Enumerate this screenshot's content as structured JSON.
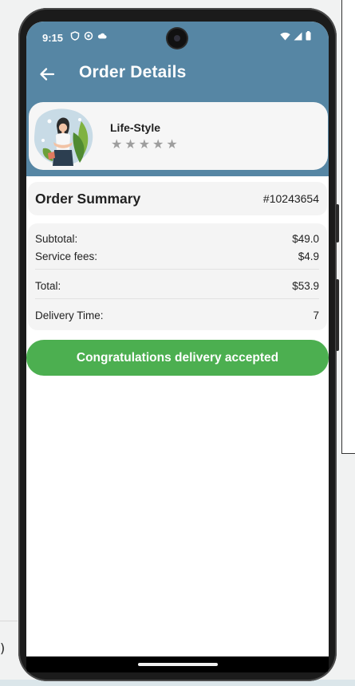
{
  "status_bar": {
    "time": "9:15"
  },
  "app_bar": {
    "title": "Order Details",
    "back_icon": "arrow-left-icon"
  },
  "store": {
    "name": "Life-Style",
    "rating_stars": 5,
    "star_color": "#9e9e9e"
  },
  "order_summary": {
    "title": "Order Summary",
    "order_id": "#10243654"
  },
  "details": {
    "subtotal_label": "Subtotal:",
    "subtotal_value": "$49.0",
    "fees_label": "Service fees:",
    "fees_value": "$4.9",
    "total_label": "Total:",
    "total_value": "$53.9",
    "delivery_label": "Delivery Time:",
    "delivery_value": "7"
  },
  "action": {
    "label": "Congratulations delivery accepted",
    "color": "#4caf50"
  },
  "background": {
    "partial_text": ")"
  },
  "colors": {
    "accent": "#5686a4",
    "success": "#4caf50"
  }
}
